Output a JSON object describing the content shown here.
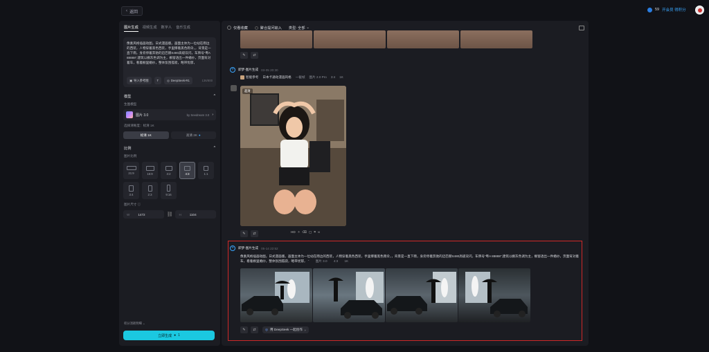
{
  "topbar": {
    "back_label": "返回",
    "credits_count": "59",
    "vip_label": "开会员 得积分"
  },
  "left": {
    "tabs": [
      "图片生成",
      "视频生成",
      "数字人",
      "音乐生成"
    ],
    "prompt_text": "像素风格插画动图。日式漫画版。画面主体为一位站在雨边的西装，人物穿着黑色西装，手里撑着黑色雨伞，，背景是一直下雨，身旁停着奔驰的迈巴赫S480高级双闪，车牌号“粤A 88888”,建筑以橱灰色调为主，橱窗透出一件婚纱，页面背对着车，看着橱里婚纱，整体氛围孤寂，略带忧郁，",
    "ref_label": "导入参考图",
    "deepseek_label": "DeepSeek-R1",
    "counter": "136/800",
    "model_section": "模型",
    "model_sub": "生图模型",
    "model_name": "图片 3.0",
    "model_by": "by Seedream 3.0",
    "res_sub": "选择清晰度：标清 1K",
    "res_options": [
      "标清 1K",
      "高清 2K"
    ],
    "ratio_section": "比例",
    "ratio_sub": "图片比例",
    "ratios": [
      "21:9",
      "16:9",
      "3:2",
      "4:3",
      "1:1",
      "3:4",
      "2:3",
      "9:16"
    ],
    "size_sub": "图片尺寸",
    "width_label": "W",
    "width_value": "1472",
    "height_label": "H",
    "height_value": "1104",
    "credit_hint": "积分消耗明细",
    "generate_label": "立即生成",
    "generate_cost": "1"
  },
  "feed": {
    "toolbar": {
      "fav": "仅看收藏",
      "merge": "聚合提问输入",
      "type": "类型: 全部"
    },
    "msg1": {
      "name": "即梦-图片生成",
      "time": "03-05  20:30",
      "ref": "智能参考",
      "prompt": "日本卡通动漫画风格",
      "cut": "一截帧",
      "model": "图片 2.0 Pro",
      "ratio": "3:4",
      "count": "1K",
      "tag": "超清"
    },
    "toolbar_icons": [
      "HD"
    ],
    "msg2": {
      "name": "即梦-图片生成",
      "time": "05-14  22:52",
      "text": "像素风格插画动图。日式漫画版。画面主体为一位站在雨边的西装，人物穿着黑色西装，手里撑着黑色雨伞，，背景是一直下雨，身旁停着奔驰的迈巴赫S480高级双闪，车牌号“粤A 88888”,建筑以橱灰色调为主，橱窗透出一件婚纱，页面背对着车，看着橱里婚纱，整体氛围孤寂，略带忧郁，",
      "model": "图片 3.0",
      "ratio": "4:3",
      "count": "1K",
      "deepseek": "用 DeepSeek 一起创作"
    }
  }
}
